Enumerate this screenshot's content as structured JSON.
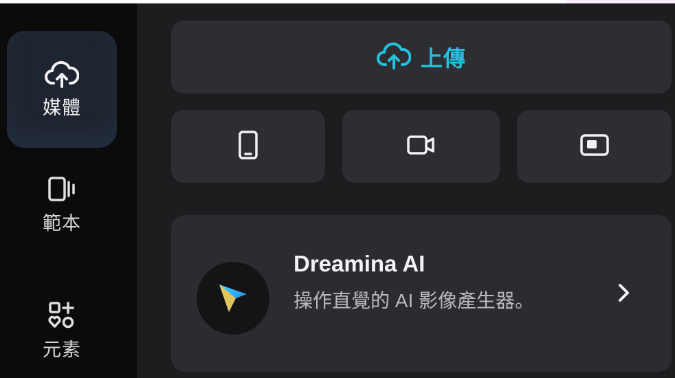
{
  "sidebar": {
    "items": [
      {
        "label": "媒體",
        "icon": "cloud-upload-icon",
        "active": true
      },
      {
        "label": "範本",
        "icon": "template-icon",
        "active": false
      },
      {
        "label": "元素",
        "icon": "elements-icon",
        "active": false
      }
    ]
  },
  "main": {
    "upload": {
      "label": "上傳",
      "icon": "cloud-upload-icon",
      "color": "#22c3df"
    },
    "tiles": [
      {
        "icon": "phone-icon"
      },
      {
        "icon": "camera-icon"
      },
      {
        "icon": "screen-record-icon"
      }
    ],
    "promo": {
      "title": "Dreamina AI",
      "description": "操作直覺的 AI 影像產生器。",
      "logo": "dreamina-logo",
      "chevron": "chevron-right-icon"
    }
  },
  "colors": {
    "accent": "#22c3df",
    "sidebar_bg": "#0b0b0c",
    "panel_bg": "#1d1d20",
    "tile_bg": "#2e2e32"
  }
}
